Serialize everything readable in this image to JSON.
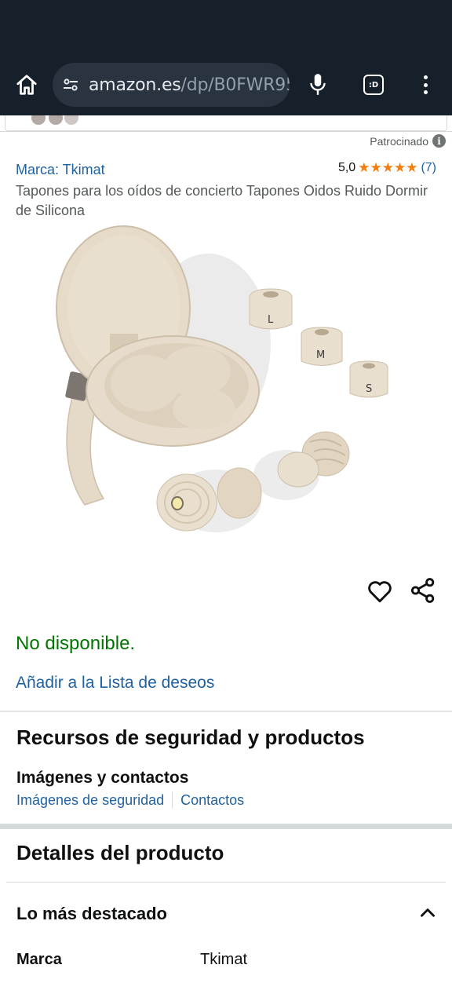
{
  "browser": {
    "url_domain": "amazon.es",
    "url_path": "/dp/B0FWR95",
    "tabs_label": ":D",
    "icons": {
      "home": "home-icon",
      "site_settings": "tune-icon",
      "mic": "mic-icon",
      "tabs": "tabs-icon",
      "menu": "more-vert-icon"
    }
  },
  "ad": {
    "sponsored_label": "Patrocinado",
    "info_icon_glyph": "i",
    "brand_link": "Marca: Tkimat",
    "rating_value": "5,0",
    "stars": [
      "★",
      "★",
      "★",
      "★",
      "★"
    ],
    "rating_count": "(7)",
    "title": "Tapones para los oídos de concierto Tapones Oidos Ruido Dormir de Silicona",
    "image_size_labels": [
      "L",
      "M",
      "S"
    ]
  },
  "actions": {
    "wishlist_icon": "heart-icon",
    "share_icon": "share-icon"
  },
  "availability": "No disponible.",
  "wishlist_link": "Añadir a la Lista de deseos",
  "safety": {
    "heading": "Recursos de seguridad y productos",
    "subheading": "Imágenes y contactos",
    "links": [
      "Imágenes de seguridad",
      "Contactos"
    ]
  },
  "details": {
    "heading": "Detalles del producto",
    "highlights": "Lo más destacado",
    "rows": [
      {
        "label": "Marca",
        "value": "Tkimat"
      }
    ]
  },
  "colors": {
    "chrome_bg": "#16202b",
    "link": "#2162a1",
    "available_status": "#007600",
    "star": "#f27d0c",
    "product": "#e9dfcf"
  }
}
